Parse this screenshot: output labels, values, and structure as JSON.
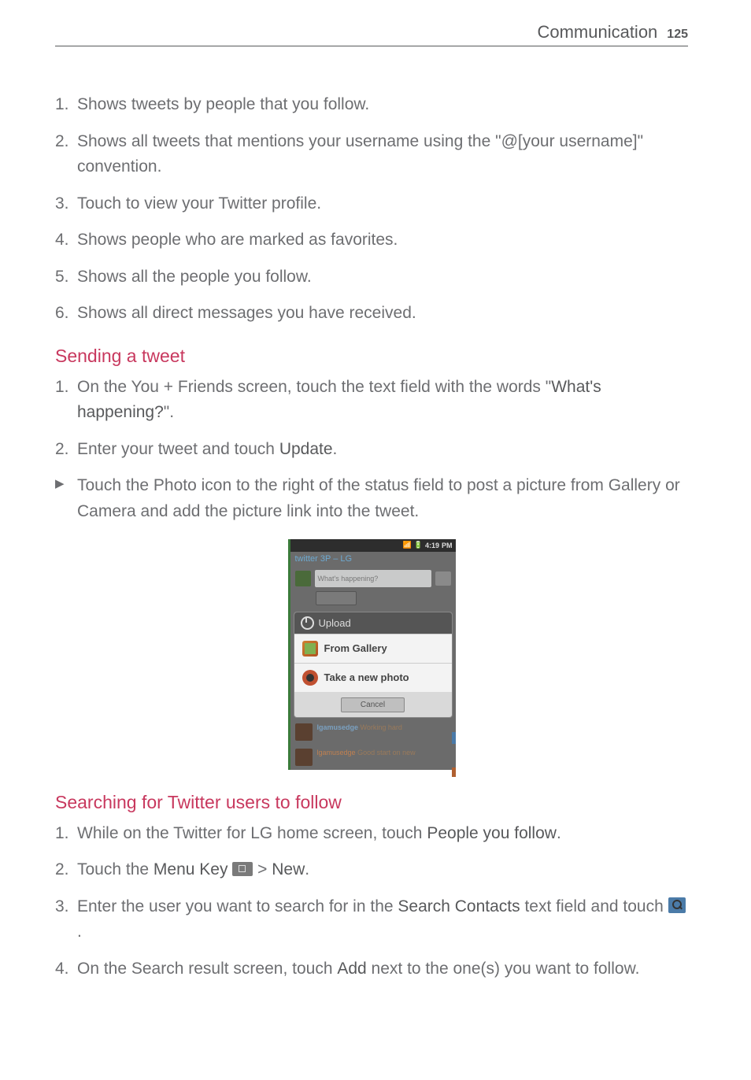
{
  "header": {
    "section": "Communication",
    "page_number": "125"
  },
  "intro_items": [
    "Shows tweets by people that you follow.",
    "Shows all tweets that mentions your username using the \"@[your username]\" convention.",
    "Touch to view your Twitter profile.",
    "Shows people who are marked as favorites.",
    "Shows all the people you follow.",
    "Shows all direct messages you have received."
  ],
  "section1": {
    "heading": "Sending a tweet",
    "step1_pre": "On the You + Friends screen, touch the text field with the words \"",
    "step1_bold": "What's happening?",
    "step1_post": "\".",
    "step2_pre": "Enter your tweet and touch ",
    "step2_bold": "Update",
    "step2_post": ".",
    "bullet": "Touch the Photo icon to the right of the status field to post a picture from Gallery or Camera and add the picture link into the tweet."
  },
  "figure": {
    "status_time": "4:19",
    "status_pm": "PM",
    "app_title": "twitter 3P – LG",
    "compose_placeholder": "What's happening?",
    "sheet_title": "Upload",
    "option_gallery": "From Gallery",
    "option_camera": "Take a new photo",
    "cancel": "Cancel",
    "feed1_user": "lgamusedge",
    "feed1_text": "Working hard",
    "feed2_user": "lgamusedge",
    "feed2_text": "Good start on new"
  },
  "section2": {
    "heading": "Searching for Twitter users to follow",
    "step1_pre": "While on the Twitter for LG home screen, touch ",
    "step1_bold": "People you follow",
    "step1_post": ".",
    "step2_pre": "Touch the ",
    "step2_bold1": "Menu Key",
    "step2_mid": "  > ",
    "step2_bold2": "New",
    "step2_post": ".",
    "step3_pre": "Enter the user you want to search for in the ",
    "step3_bold": "Search Contacts",
    "step3_mid": " text field and touch ",
    "step3_post": ".",
    "step4_pre": "On the Search result screen, touch ",
    "step4_bold": "Add",
    "step4_post": " next to the one(s) you want to follow."
  }
}
